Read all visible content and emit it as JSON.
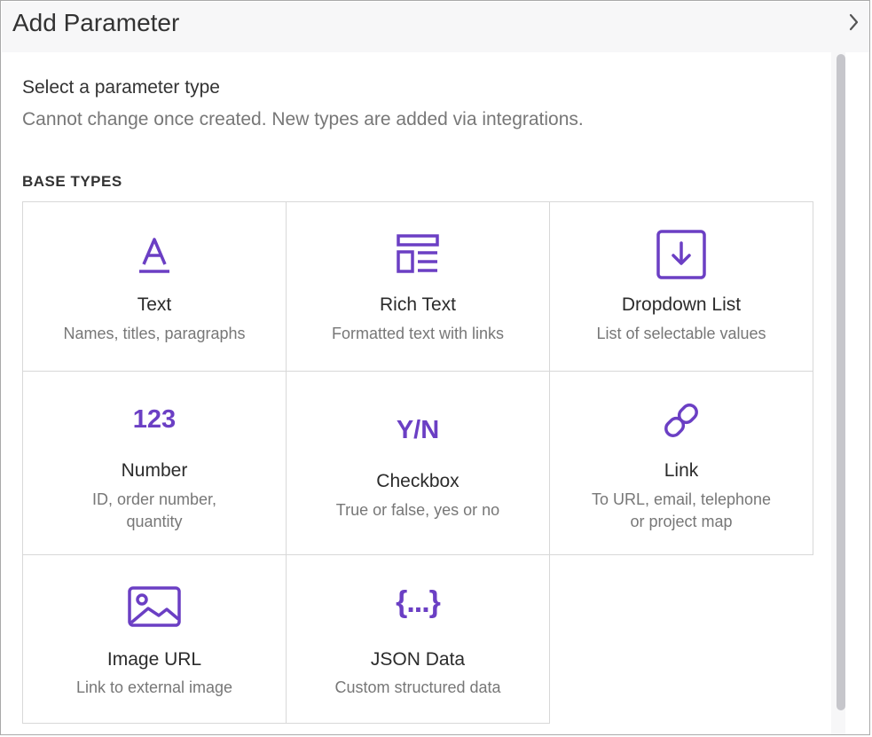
{
  "header": {
    "title": "Add Parameter",
    "collapse_icon": "chevron-right-icon"
  },
  "intro": {
    "title": "Select a parameter type",
    "subtitle": "Cannot change once created. New types are added via integrations."
  },
  "section": {
    "label": "BASE TYPES"
  },
  "accent_color": "#6b3fc4",
  "types": [
    {
      "title": "Text",
      "description": "Names, titles, paragraphs",
      "icon": "text-icon"
    },
    {
      "title": "Rich Text",
      "description": "Formatted text with links",
      "icon": "rich-text-icon"
    },
    {
      "title": "Dropdown List",
      "description": "List of selectable values",
      "icon": "dropdown-icon"
    },
    {
      "title": "Number",
      "description_lines": [
        "ID, order number,",
        "quantity"
      ],
      "icon": "number-icon",
      "icon_text": "123"
    },
    {
      "title": "Checkbox",
      "description": "True or false, yes or no",
      "icon": "checkbox-icon",
      "icon_text": "Y/N"
    },
    {
      "title": "Link",
      "description_lines": [
        "To URL, email, telephone",
        "or project map"
      ],
      "icon": "link-icon"
    },
    {
      "title": "Image URL",
      "description": "Link to external image",
      "icon": "image-icon"
    },
    {
      "title": "JSON Data",
      "description": "Custom structured data",
      "icon": "json-icon",
      "icon_text": "{...}"
    }
  ]
}
